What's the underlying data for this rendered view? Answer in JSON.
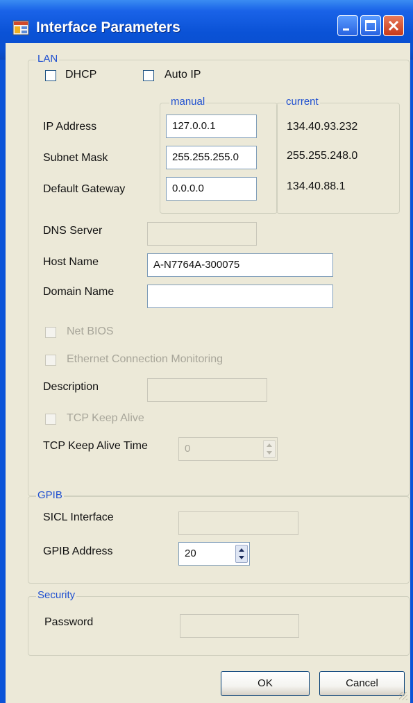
{
  "window": {
    "title": "Interface Parameters",
    "icon": "app-icon"
  },
  "lan": {
    "legend": "LAN",
    "dhcp_label": "DHCP",
    "autoip_label": "Auto IP",
    "manual_legend": "manual",
    "current_legend": "current",
    "ip_label": "IP Address",
    "ip_manual": "127.0.0.1",
    "ip_current": "134.40.93.232",
    "subnet_label": "Subnet Mask",
    "subnet_manual": "255.255.255.0",
    "subnet_current": "255.255.248.0",
    "gateway_label": "Default Gateway",
    "gateway_manual": "0.0.0.0",
    "gateway_current": "134.40.88.1",
    "dns_label": "DNS Server",
    "dns_value": "",
    "host_label": "Host Name",
    "host_value": "A-N7764A-300075",
    "domain_label": "Domain Name",
    "domain_value": "",
    "netbios_label": "Net BIOS",
    "ethmon_label": "Ethernet Connection Monitoring",
    "desc_label": "Description",
    "desc_value": "",
    "keepalive_label": "TCP Keep Alive",
    "keepalive_time_label": "TCP Keep Alive Time",
    "keepalive_time_value": "0"
  },
  "gpib": {
    "legend": "GPIB",
    "sicl_label": "SICL Interface",
    "sicl_value": "",
    "address_label": "GPIB Address",
    "address_value": "20"
  },
  "security": {
    "legend": "Security",
    "password_label": "Password",
    "password_value": ""
  },
  "buttons": {
    "ok": "OK",
    "cancel": "Cancel"
  }
}
